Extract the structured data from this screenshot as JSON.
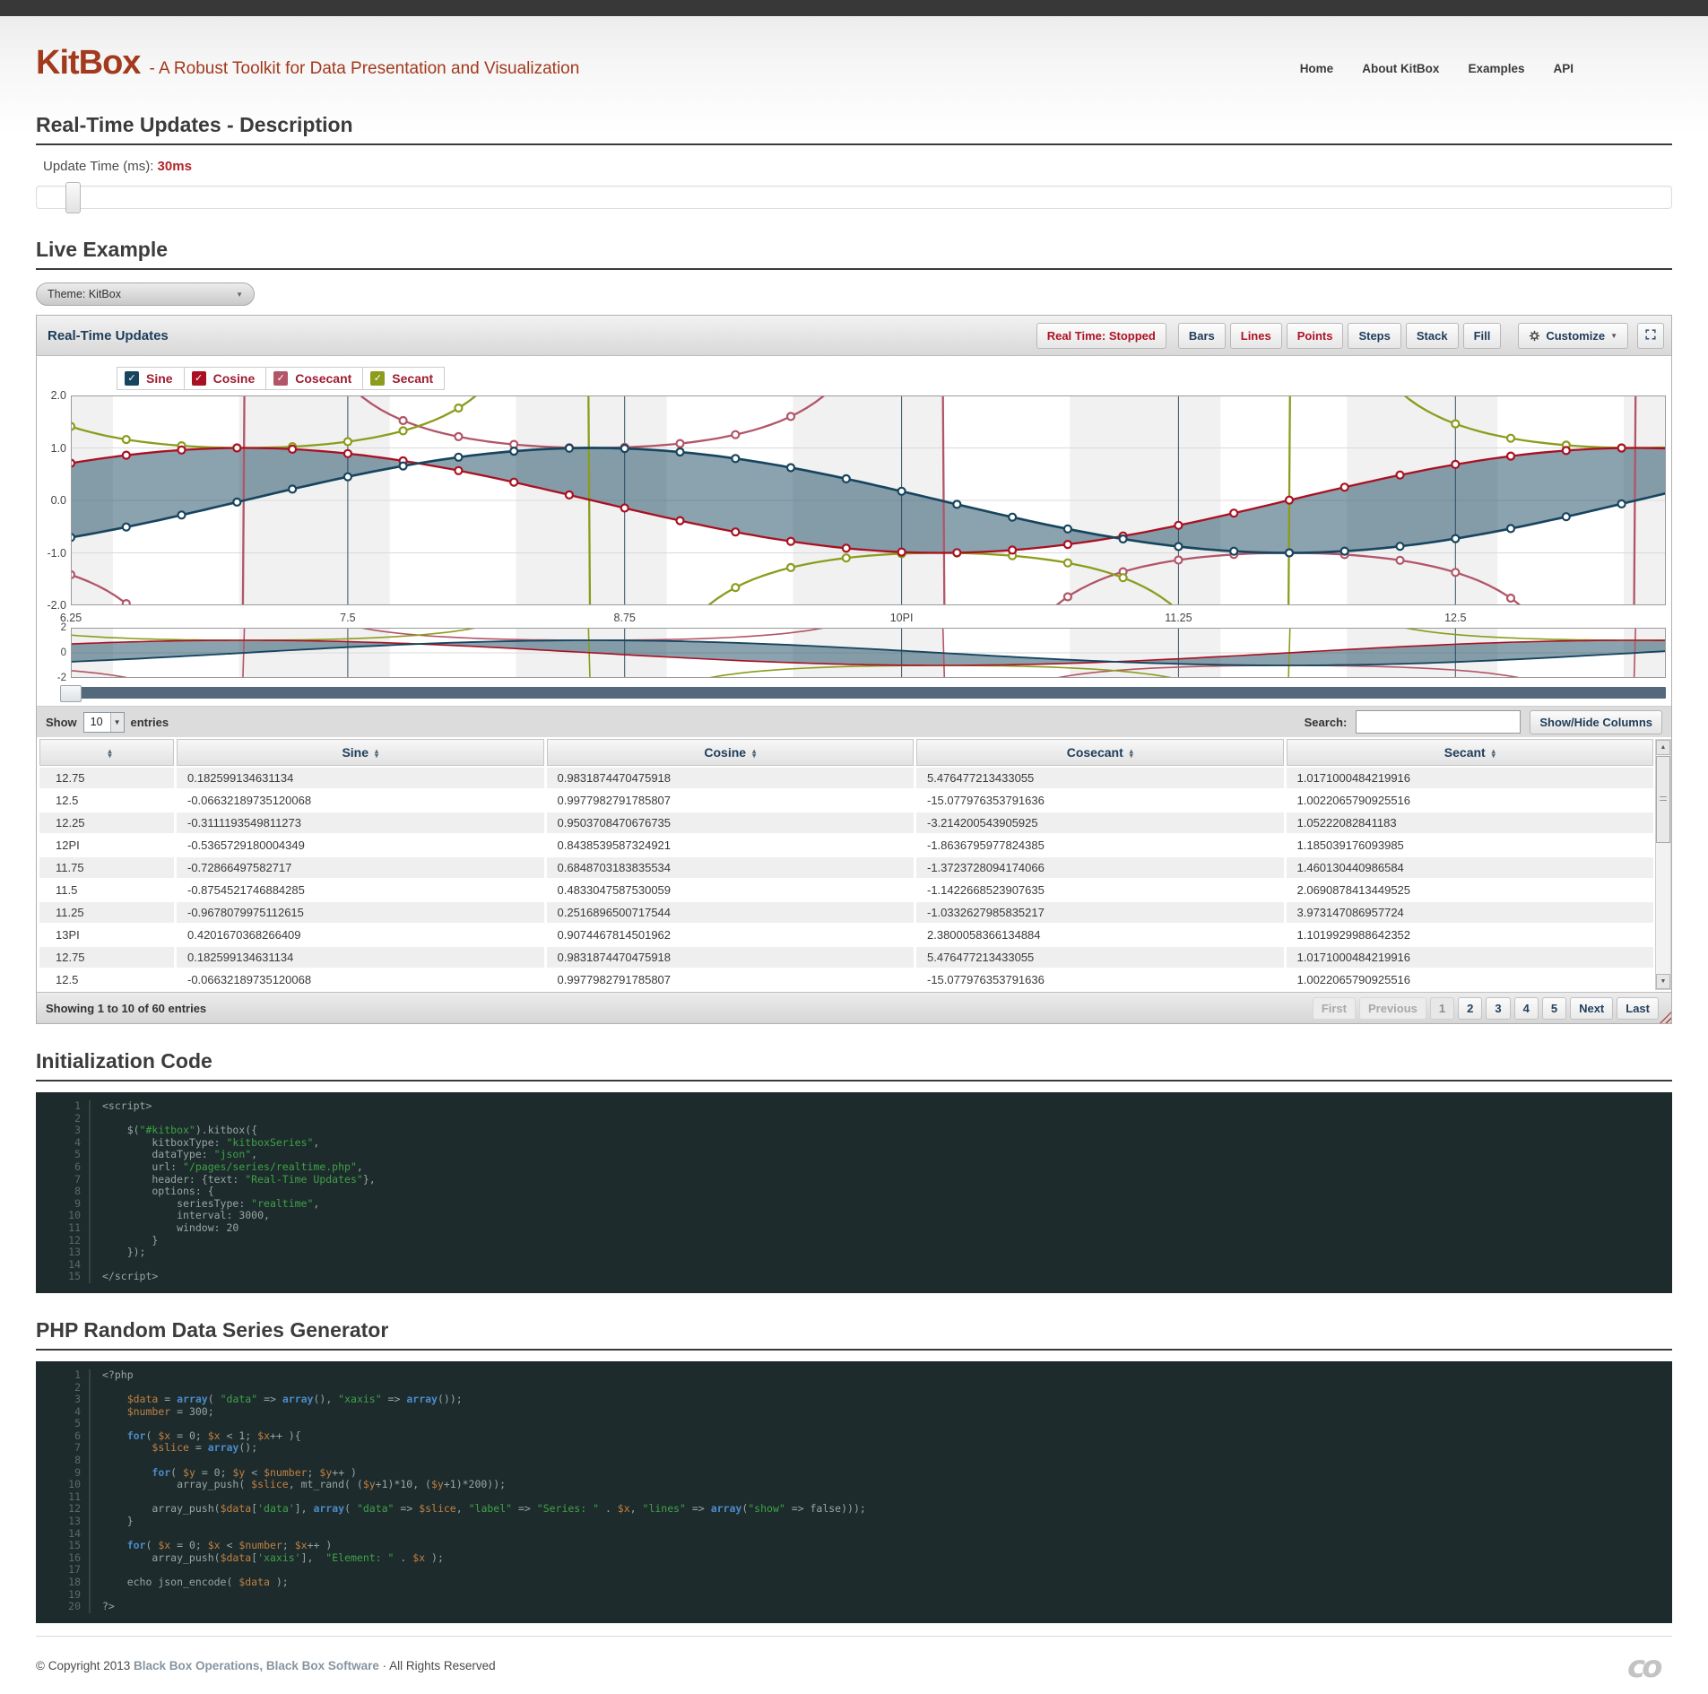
{
  "header": {
    "brand": "KitBox",
    "tagline": "- A Robust Toolkit for Data Presentation and Visualization",
    "nav": [
      "Home",
      "About KitBox",
      "Examples",
      "API"
    ]
  },
  "description": {
    "heading": "Real-Time Updates - Description",
    "update_time_label": "Update Time (ms):",
    "update_time_value": "30ms"
  },
  "live": {
    "heading": "Live Example",
    "theme_select": "Theme: KitBox"
  },
  "widget": {
    "title": "Real-Time Updates",
    "toolbar": [
      {
        "label": "Real Time: Stopped",
        "active": true,
        "first": true
      },
      {
        "label": "Bars"
      },
      {
        "label": "Lines",
        "active": true
      },
      {
        "label": "Points",
        "active": true
      },
      {
        "label": "Steps"
      },
      {
        "label": "Stack"
      },
      {
        "label": "Fill"
      }
    ],
    "customize_label": "Customize",
    "legend": [
      {
        "label": "Sine",
        "color": "#17455f"
      },
      {
        "label": "Cosine",
        "color": "#a91122"
      },
      {
        "label": "Cosecant",
        "color": "#b25568"
      },
      {
        "label": "Secant",
        "color": "#8c9c1c"
      }
    ]
  },
  "chart_data": {
    "type": "line",
    "title": "Real-Time Updates",
    "x_domain": [
      6.25,
      13.45
    ],
    "ylim": [
      -2,
      2
    ],
    "phase_shift": 0.75,
    "marker_step": 0.25,
    "line_step": 0.04,
    "x_tick_values": [
      6.25,
      7.5,
      8.75,
      10,
      11.25,
      12.5
    ],
    "x_tick_labels": [
      "6.25",
      "7.5",
      "8.75",
      "10PI",
      "11.25",
      "12.5"
    ],
    "y_tick_labels_main": [
      "2.0",
      "1.0",
      "0.0",
      "-1.0",
      "-2.0"
    ],
    "y_tick_labels_mini": [
      "2",
      "0",
      "-2"
    ],
    "stripe_starts": [
      5.76,
      7.01,
      8.26,
      9.51,
      10.76,
      12.01,
      13.26
    ],
    "stripe_width": 0.68,
    "stripe_color": "#f1f1f1",
    "grid_color": "#dadada",
    "tickline_color": "#1e3d52",
    "series": [
      {
        "name": "Sine",
        "fn": "sin",
        "color": "#17455f"
      },
      {
        "name": "Cosine",
        "fn": "cos",
        "color": "#a91122"
      },
      {
        "name": "Cosecant",
        "fn": "csc",
        "color": "#b25568"
      },
      {
        "name": "Secant",
        "fn": "sec",
        "color": "#8c9c1c"
      }
    ],
    "fill_between": [
      "Sine",
      "Cosine"
    ],
    "fill_color": "#17455f",
    "fill_opacity": 0.5
  },
  "table": {
    "show_label": "Show",
    "show_value": "10",
    "entries_label": "entries",
    "search_label": "Search:",
    "showhide_label": "Show/Hide Columns",
    "columns": [
      "",
      "Sine",
      "Cosine",
      "Cosecant",
      "Secant"
    ],
    "rows": [
      [
        "12.75",
        "0.182599134631134",
        "0.9831874470475918",
        "5.476477213433055",
        "1.0171000484219916"
      ],
      [
        "12.5",
        "-0.06632189735120068",
        "0.9977982791785807",
        "-15.077976353791636",
        "1.0022065790925516"
      ],
      [
        "12.25",
        "-0.3111193549811273",
        "0.9503708470676735",
        "-3.214200543905925",
        "1.05222082841183"
      ],
      [
        "12PI",
        "-0.5365729180004349",
        "0.8438539587324921",
        "-1.8636795977824385",
        "1.185039176093985"
      ],
      [
        "11.75",
        "-0.72866497582717",
        "0.6848703183835534",
        "-1.3723728094174066",
        "1.460130440986584"
      ],
      [
        "11.5",
        "-0.8754521746884285",
        "0.4833047587530059",
        "-1.1422668523907635",
        "2.0690878413449525"
      ],
      [
        "11.25",
        "-0.9678079975112615",
        "0.2516896500717544",
        "-1.0332627985835217",
        "3.973147086957724"
      ],
      [
        "13PI",
        "0.4201670368266409",
        "0.9074467814501962",
        "2.3800058366134884",
        "1.1019929988642352"
      ],
      [
        "12.75",
        "0.182599134631134",
        "0.9831874470475918",
        "5.476477213433055",
        "1.0171000484219916"
      ],
      [
        "12.5",
        "-0.06632189735120068",
        "0.9977982791785807",
        "-15.077976353791636",
        "1.0022065790925516"
      ]
    ],
    "info": "Showing 1 to 10 of 60 entries",
    "pagination": [
      {
        "label": "First",
        "state": "disabled"
      },
      {
        "label": "Previous",
        "state": "disabled"
      },
      {
        "label": "1",
        "state": "current"
      },
      {
        "label": "2"
      },
      {
        "label": "3"
      },
      {
        "label": "4"
      },
      {
        "label": "5"
      },
      {
        "label": "Next"
      },
      {
        "label": "Last"
      }
    ]
  },
  "init_code": {
    "heading": "Initialization Code",
    "lines": [
      "<script>",
      "",
      "    $(\"#kitbox\").kitbox({",
      "        kitboxType: \"kitboxSeries\",",
      "        dataType: \"json\",",
      "        url: \"/pages/series/realtime.php\",",
      "        header: {text: \"Real-Time Updates\"},",
      "        options: {",
      "            seriesType: \"realtime\",",
      "            interval: 3000,",
      "            window: 20",
      "        }",
      "    });",
      "",
      "</script>"
    ]
  },
  "php_code": {
    "heading": "PHP Random Data Series Generator",
    "lines": [
      "<?php",
      "",
      "    $data = array( \"data\" => array(), \"xaxis\" => array());",
      "    $number = 300;",
      "",
      "    for( $x = 0; $x < 1; $x++ ){",
      "        $slice = array();",
      "",
      "        for( $y = 0; $y < $number; $y++ )",
      "            array_push( $slice, mt_rand( ($y+1)*10, ($y+1)*200));",
      "",
      "        array_push($data['data'], array( \"data\" => $slice, \"label\" => \"Series: \" . $x, \"lines\" => array(\"show\" => false)));",
      "    }",
      "",
      "    for( $x = 0; $x < $number; $x++ )",
      "        array_push($data['xaxis'],  \"Element: \" . $x );",
      "",
      "    echo json_encode( $data );",
      "",
      "?>"
    ]
  },
  "footer": {
    "copyright_prefix": "© Copyright 2013",
    "company": "Black Box Operations, Black Box Software",
    "suffix": "· All Rights Reserved"
  }
}
